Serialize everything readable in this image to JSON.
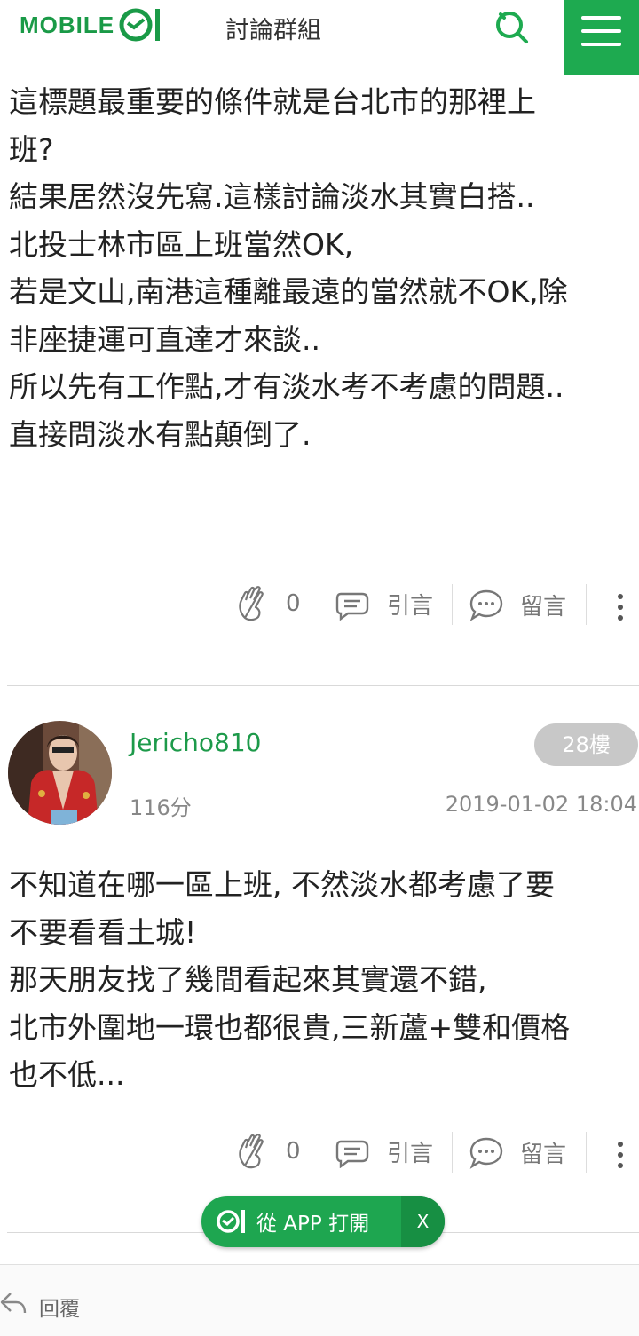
{
  "header": {
    "logo_text": "MOBILE",
    "title": "討論群組"
  },
  "posts": [
    {
      "lines": [
        "這標題最重要的條件就是台北市的那裡上",
        "班?",
        "結果居然沒先寫.這樣討論淡水其實白搭..",
        "北投士林市區上班當然OK,",
        "若是文山,南港這種離最遠的當然就不OK,除",
        "非座捷運可直達才來談..",
        "所以先有工作點,才有淡水考不考慮的問題..",
        "直接問淡水有點顛倒了."
      ],
      "likes": "0",
      "quote_label": "引言",
      "comment_label": "留言"
    },
    {
      "username": "Jericho810",
      "score": "116分",
      "floor": "28樓",
      "date": "2019-01-02 18:04",
      "lines": [
        "不知道在哪一區上班, 不然淡水都考慮了要",
        "不要看看土城!",
        "那天朋友找了幾間看起來其實還不錯,",
        "北市外圍地一環也都很貴,三新蘆+雙和價格",
        "也不低..."
      ],
      "likes": "0",
      "quote_label": "引言",
      "comment_label": "留言"
    }
  ],
  "app_banner": {
    "open_label": "從 APP 打開",
    "close_label": "X"
  },
  "bottom_bar": {
    "reply_label": "回覆"
  },
  "colors": {
    "brand_green": "#1eaa50",
    "username_green": "#1d9a4a",
    "badge_grey": "#c8c8c8"
  }
}
